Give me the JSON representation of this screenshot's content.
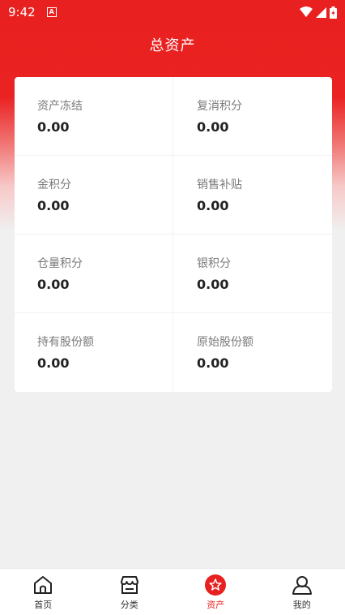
{
  "status_bar": {
    "time": "9:42",
    "a_icon": "A"
  },
  "header": {
    "title": "总资产"
  },
  "assets": [
    {
      "label": "资产冻结",
      "value": "0.00"
    },
    {
      "label": "复消积分",
      "value": "0.00"
    },
    {
      "label": "金积分",
      "value": "0.00"
    },
    {
      "label": "销售补贴",
      "value": "0.00"
    },
    {
      "label": "仓量积分",
      "value": "0.00"
    },
    {
      "label": "银积分",
      "value": "0.00"
    },
    {
      "label": "持有股份额",
      "value": "0.00"
    },
    {
      "label": "原始股份额",
      "value": "0.00"
    }
  ],
  "tabbar": {
    "items": [
      {
        "label": "首页",
        "icon": "home-icon"
      },
      {
        "label": "分类",
        "icon": "store-icon"
      },
      {
        "label": "资产",
        "icon": "star-badge-icon",
        "active": true
      },
      {
        "label": "我的",
        "icon": "user-icon"
      }
    ]
  },
  "colors": {
    "accent": "#e8201f",
    "background": "#f0f0f0"
  }
}
